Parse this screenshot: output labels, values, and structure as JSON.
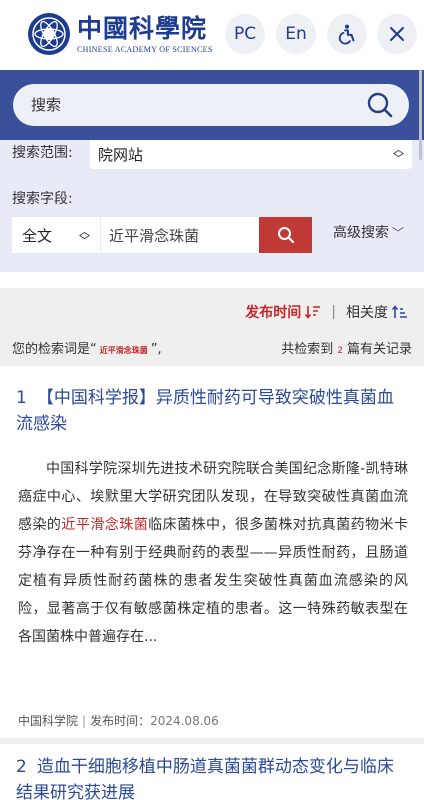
{
  "header": {
    "logo_cn": "中國科學院",
    "logo_en": "CHINESE ACADEMY OF SCIENCES",
    "pc_label": "PC",
    "en_label": "En",
    "accessibility_icon": "accessibility-icon",
    "close_icon": "close-icon"
  },
  "search": {
    "placeholder": "搜索",
    "icon": "search-icon"
  },
  "filters": {
    "range_label": "搜索范围:",
    "range_value": "院网站",
    "field_label": "搜索字段:",
    "field_value": "全文",
    "keyword_value": "近平滑念珠菌",
    "advanced_label": "高级搜索"
  },
  "sort": {
    "time_label": "发布时间",
    "relevance_label": "相关度",
    "separator": "|"
  },
  "stats": {
    "prefix": "您的检索词是“",
    "keyword": "近平滑念珠菌",
    "suffix": "”,",
    "total_prefix": "共检索到",
    "count": "2",
    "total_suffix": "篇有关记录"
  },
  "results": [
    {
      "index": "1",
      "title": "【中国科学报】异质性耐药可导致突破性真菌血流感染",
      "body_before": "中国科学院深圳先进技术研究院联合美国纪念斯隆-凯特琳癌症中心、埃默里大学研究团队发现，在导致突破性真菌血流感染的",
      "body_highlight": "近平滑念珠菌",
      "body_after": "临床菌株中，很多菌株对抗真菌药物米卡芬净存在一种有别于经典耐药的表型——异质性耐药，且肠道定植有异质性耐药菌株的患者发生突破性真菌血流感染的风险，显著高于仅有敏感菌株定植的患者。这一特殊药敏表型在各国菌株中普遍存在...",
      "source": "中国科学院",
      "meta_sep": "|",
      "date_label": "发布时间：",
      "date": "2024.08.06"
    },
    {
      "index": "2",
      "title": "造血干细胞移植中肠道真菌菌群动态变化与临床结果研究获进展"
    }
  ],
  "colors": {
    "brand_blue": "#3a509b",
    "accent_red": "#c4282b",
    "title_blue": "#2c4a9a"
  }
}
